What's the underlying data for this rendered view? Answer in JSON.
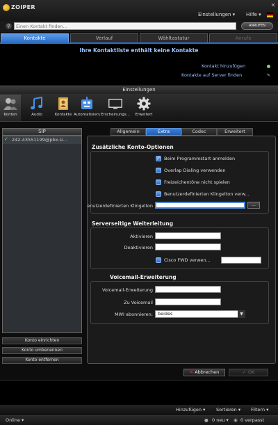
{
  "window": {
    "title": "ZOIPER"
  },
  "menu": {
    "settings": "Einstellungen ▾",
    "help": "Hilfe ▾"
  },
  "search": {
    "placeholder": "Einen Kontakt finden...",
    "call_label": "ANRUFEN"
  },
  "main_tabs": [
    {
      "label": "Kontakte"
    },
    {
      "label": "Verlauf"
    },
    {
      "label": "Wähltastatur"
    },
    {
      "label": "Anrufe"
    }
  ],
  "contacts": {
    "empty_message": "Ihre Kontaktliste enthält keine Kontakte",
    "add_contact": "Kontakt hinzufügen",
    "find_on_server": "Kontakte auf Server finden"
  },
  "settings": {
    "header": "Einstellungen",
    "toolbar": [
      {
        "label": "Konten",
        "icon": "accounts-icon"
      },
      {
        "label": "Audio",
        "icon": "audio-icon"
      },
      {
        "label": "Kontakte",
        "icon": "contacts-icon"
      },
      {
        "label": "Automatisierung",
        "icon": "automation-icon"
      },
      {
        "label": "Erscheinungs...",
        "icon": "appearance-icon"
      },
      {
        "label": "Erweitert",
        "icon": "gear-icon"
      }
    ],
    "accounts": {
      "header": "SIP",
      "items": [
        {
          "name": "242-43551199@pbx.si..."
        }
      ],
      "buttons": {
        "setup": "Konto einrichten",
        "rename": "Konto umbenennen",
        "remove": "Konto entfernen"
      }
    },
    "sub_tabs": [
      {
        "label": "Allgemein"
      },
      {
        "label": "Extra"
      },
      {
        "label": "Codec"
      },
      {
        "label": "Erweitert"
      }
    ],
    "extra": {
      "options_title": "Zusätzliche Konto-Optionen",
      "opt_startup": "Beim Programmstart anmelden",
      "opt_overlap": "Overlap Dialing verwenden",
      "opt_no_freetone": "Freizeichentöne nicht spielen",
      "opt_custom_ringtone": "Benutzerdefinierten Klingelton verw...",
      "ringtone_label": "Benutzerdefinierten Klingelton:",
      "ringtone_value": "",
      "browse_label": "...",
      "forward_title": "Serverseitige Weiterleitung",
      "activate_label": "Aktivieren",
      "deactivate_label": "Deaktivieren",
      "cisco_label": "Cisco FWD verwen...",
      "voicemail_title": "Voicemail-Erweiterung",
      "vm_extension_label": "Voicemail-Erweiterung",
      "to_voicemail_label": "Zu Voicemail",
      "mwi_label": "MWI abonnieren:",
      "mwi_value": "beides"
    },
    "dialog": {
      "cancel": "Abbrechen",
      "ok": "OK"
    }
  },
  "bottom_menu": {
    "add": "Hinzufügen ▾",
    "sort": "Sortieren ▾",
    "filter": "Filtern ▾"
  },
  "status": {
    "online": "Online ▾",
    "new": "0 neu ▾",
    "missed": "0 verpasst"
  },
  "colors": {
    "accent": "#2d6ec4",
    "link": "#9ec3ff",
    "cancel_icon": "#e33333"
  }
}
